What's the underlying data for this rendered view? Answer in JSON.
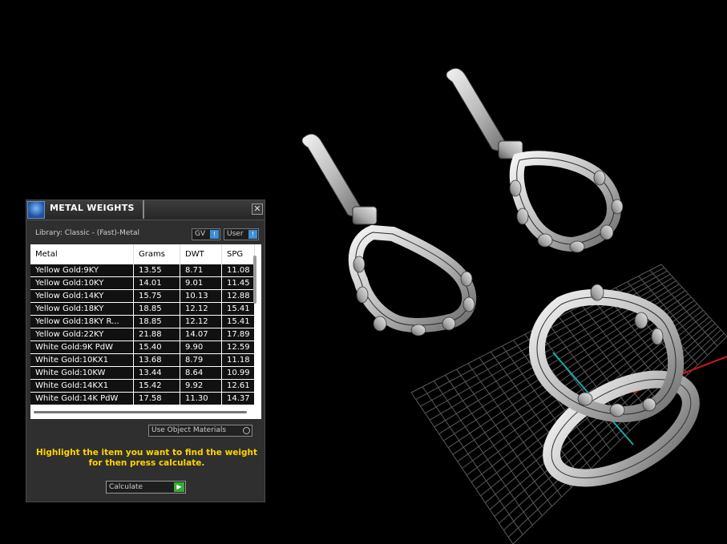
{
  "panel": {
    "title": "METAL WEIGHTS",
    "close_glyph": "✕",
    "library_label": "Library: Classic - (Fast)-Metal",
    "toggle_gv": "GV",
    "toggle_user": "User",
    "toggle_knob": "!",
    "columns": [
      "Metal",
      "Grams",
      "DWT",
      "SPG"
    ],
    "rows": [
      [
        "Yellow Gold:9KY",
        "13.55",
        "8.71",
        "11.08"
      ],
      [
        "Yellow Gold:10KY",
        "14.01",
        "9.01",
        "11.45"
      ],
      [
        "Yellow Gold:14KY",
        "15.75",
        "10.13",
        "12.88"
      ],
      [
        "Yellow Gold:18KY",
        "18.85",
        "12.12",
        "15.41"
      ],
      [
        "Yellow Gold:18KY R...",
        "18.85",
        "12.12",
        "15.41"
      ],
      [
        "Yellow Gold:22KY",
        "21.88",
        "14.07",
        "17.89"
      ],
      [
        "White Gold:9K PdW",
        "15.40",
        "9.90",
        "12.59"
      ],
      [
        "White Gold:10KX1",
        "13.68",
        "8.79",
        "11.18"
      ],
      [
        "White Gold:10KW",
        "13.44",
        "8.64",
        "10.99"
      ],
      [
        "White Gold:14KX1",
        "15.42",
        "9.92",
        "12.61"
      ],
      [
        "White Gold:14K PdW",
        "17.58",
        "11.30",
        "14.37"
      ]
    ],
    "use_object_materials": "Use Object Materials",
    "instructions": "Highlight the item you want to find the weight for then press calculate.",
    "calculate_label": "Calculate",
    "calculate_glyph": "▶"
  },
  "icons": {
    "logo": "app-logo-icon",
    "close": "close-icon",
    "calculate": "play-icon"
  },
  "colors": {
    "instruction_text": "#ffd400",
    "toggle_accent": "#3c8fd6",
    "calculate_accent": "#3aa83a",
    "grid_axis_red": "#d01818",
    "grid_axis_teal": "#1aa6a6"
  }
}
